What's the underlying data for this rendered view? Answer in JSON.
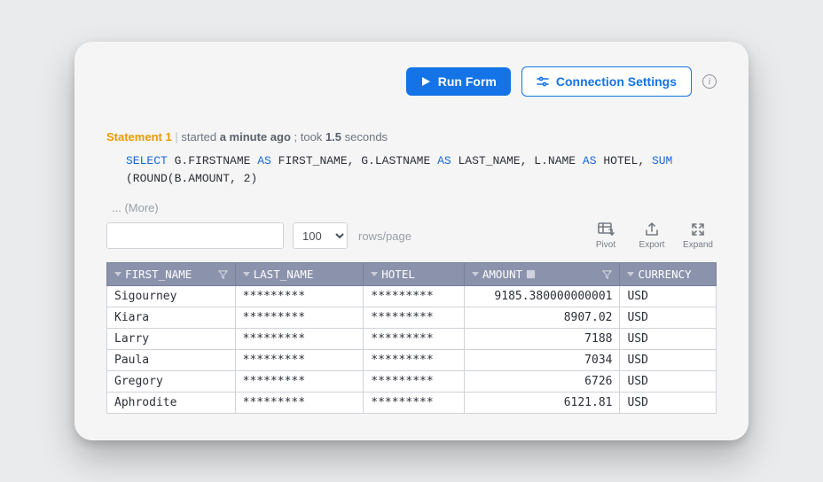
{
  "toolbar": {
    "run_label": "Run Form",
    "conn_label": "Connection Settings"
  },
  "statement": {
    "title": "Statement 1",
    "started_word": "started",
    "started_ago": "a minute ago",
    "took_word": "; took",
    "took_value": "1.5",
    "took_unit": "seconds"
  },
  "sql": {
    "kw_select": "SELECT",
    "seg1": " G.FIRSTNAME ",
    "kw_as1": "AS",
    "seg2": " FIRST_NAME, G.LASTNAME ",
    "kw_as2": "AS",
    "seg3": " LAST_NAME, L.NAME ",
    "kw_as3": "AS",
    "seg4": " HOTEL, ",
    "kw_sum": "SUM",
    "seg5": " (ROUND(B.AMOUNT, 2)"
  },
  "more_label": "... (More)",
  "controls": {
    "rows_per_page": "100",
    "rows_label": "rows/page",
    "pivot": "Pivot",
    "export": "Export",
    "expand": "Expand"
  },
  "columns": [
    "FIRST_NAME",
    "LAST_NAME",
    "HOTEL",
    "AMOUNT",
    "CURRENCY"
  ],
  "rows": [
    {
      "fn": "Sigourney",
      "ln": "*********",
      "ht": "*********",
      "am": "9185.380000000001",
      "cu": "USD"
    },
    {
      "fn": "Kiara",
      "ln": "*********",
      "ht": "*********",
      "am": "8907.02",
      "cu": "USD"
    },
    {
      "fn": "Larry",
      "ln": "*********",
      "ht": "*********",
      "am": "7188",
      "cu": "USD"
    },
    {
      "fn": "Paula",
      "ln": "*********",
      "ht": "*********",
      "am": "7034",
      "cu": "USD"
    },
    {
      "fn": "Gregory",
      "ln": "*********",
      "ht": "*********",
      "am": "6726",
      "cu": "USD"
    },
    {
      "fn": "Aphrodite",
      "ln": "*********",
      "ht": "*********",
      "am": "6121.81",
      "cu": "USD"
    }
  ]
}
